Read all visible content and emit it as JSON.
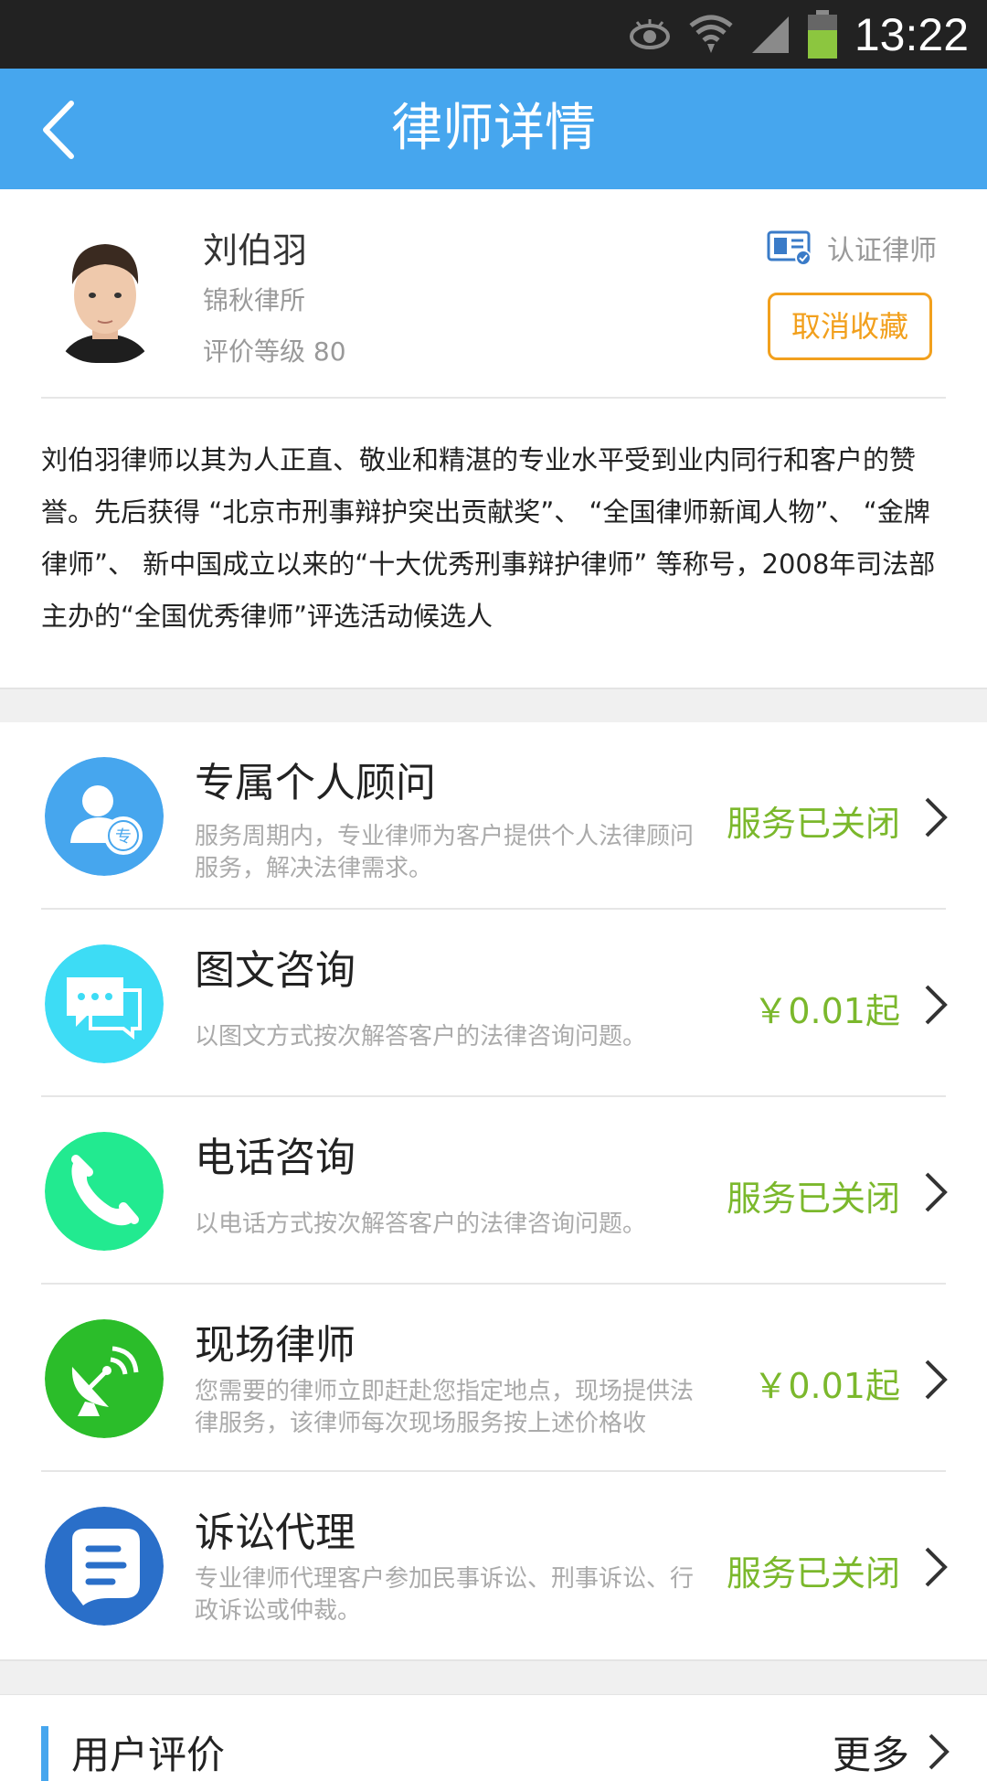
{
  "status_bar": {
    "time": "13:22",
    "icons": [
      "eye-icon",
      "wifi-icon",
      "signal-icon",
      "battery-icon"
    ]
  },
  "header": {
    "title": "律师详情",
    "back_icon": "back-arrow-icon"
  },
  "lawyer": {
    "name": "刘伯羽",
    "firm": "锦秋律所",
    "rating": "评价等级 80",
    "cert_label": "认证律师",
    "favorite_button": "取消收藏",
    "bio": "刘伯羽律师以其为人正直、敬业和精湛的专业水平受到业内同行和客户的赞誉。先后获得 “北京市刑事辩护突出贡献奖”、 “全国律师新闻人物”、 “金牌律师”、 新中国成立以来的“十大优秀刑事辩护律师” 等称号，2008年司法部主办的“全国优秀律师”评选活动候选人"
  },
  "services": [
    {
      "title": "专属个人顾问",
      "desc": "服务周期内，专业律师为客户提供个人法律顾问服务，解决法律需求。",
      "status": "服务已关闭",
      "icon": "personal-advisor-icon",
      "color": "#46a6ee"
    },
    {
      "title": "图文咨询",
      "desc": "以图文方式按次解答客户的法律咨询问题。",
      "status": "￥0.01起",
      "icon": "chat-bubble-icon",
      "color": "#3ddcf5"
    },
    {
      "title": "电话咨询",
      "desc": "以电话方式按次解答客户的法律咨询问题。",
      "status": "服务已关闭",
      "icon": "phone-icon",
      "color": "#22ea90"
    },
    {
      "title": "现场律师",
      "desc": "您需要的律师立即赶赴您指定地点，现场提供法律服务，该律师每次现场服务按上述价格收",
      "status": "￥0.01起",
      "icon": "satellite-dish-icon",
      "color": "#2bbd2a"
    },
    {
      "title": "诉讼代理",
      "desc": "专业律师代理客户参加民事诉讼、刑事诉讼、行政诉讼或仲裁。",
      "status": "服务已关闭",
      "icon": "litigation-icon",
      "color": "#2a6fc9"
    }
  ],
  "reviews": {
    "title": "用户评价",
    "more": "更多"
  },
  "colors": {
    "primary": "#46a6ee",
    "accent_orange": "#f2a01d",
    "status_green": "#7bb82c"
  }
}
